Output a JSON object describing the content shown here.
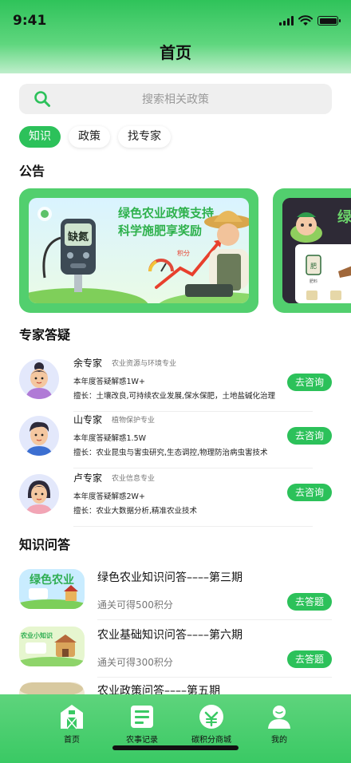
{
  "status_bar": {
    "time": "9:41"
  },
  "header": {
    "title": "首页"
  },
  "search": {
    "placeholder": "搜索相关政策"
  },
  "tabs": [
    {
      "label": "知识",
      "active": true
    },
    {
      "label": "政策",
      "active": false
    },
    {
      "label": "找专家",
      "active": false
    }
  ],
  "announcements": {
    "title": "公告",
    "banners": [
      {
        "headline_line1": "绿色农业政策支持",
        "headline_line2": "科学施肥享奖励",
        "device_text": "缺氮",
        "chart_label": "积分"
      },
      {
        "headline": "绿",
        "sack_text": "肥",
        "sack_caption": "肥料"
      }
    ]
  },
  "experts": {
    "title": "专家答疑",
    "items": [
      {
        "name": "余专家",
        "field": "农业资源与环境专业",
        "stat": "本年度答疑解惑1W+",
        "specialty": "擅长：土壤改良,可持续农业发展,保水保肥，土地盐碱化治理",
        "button": "去咨询"
      },
      {
        "name": "山专家",
        "field": "植物保护专业",
        "stat": "本年度答疑解惑1.5W",
        "specialty": "擅长：农业昆虫与害虫研究,生态调控,物理防治病虫害技术",
        "button": "去咨询"
      },
      {
        "name": "卢专家",
        "field": "农业信息专业",
        "stat": "本年度答疑解惑2W+",
        "specialty": "擅长：农业大数据分析,精准农业技术",
        "button": "去咨询"
      }
    ]
  },
  "quizzes": {
    "title": "知识问答",
    "items": [
      {
        "title": "绿色农业知识问答––––第三期",
        "subtitle": "通关可得500积分",
        "button": "去答题",
        "thumb_text": "绿色农业"
      },
      {
        "title": "农业基础知识问答––––第六期",
        "subtitle": "通关可得300积分",
        "button": "去答题",
        "thumb_text": "农业小知识"
      },
      {
        "title": "农业政策问答––––第五期",
        "subtitle": "",
        "button": "",
        "thumb_text": ""
      }
    ]
  },
  "tabbar": {
    "items": [
      {
        "label": "首页",
        "icon": "barn-icon"
      },
      {
        "label": "农事记录",
        "icon": "record-icon"
      },
      {
        "label": "碳积分商城",
        "icon": "carbon-mall-icon"
      },
      {
        "label": "我的",
        "icon": "profile-icon"
      }
    ]
  },
  "colors": {
    "brand_green": "#2cc15a",
    "banner_green": "#52cf6e"
  }
}
